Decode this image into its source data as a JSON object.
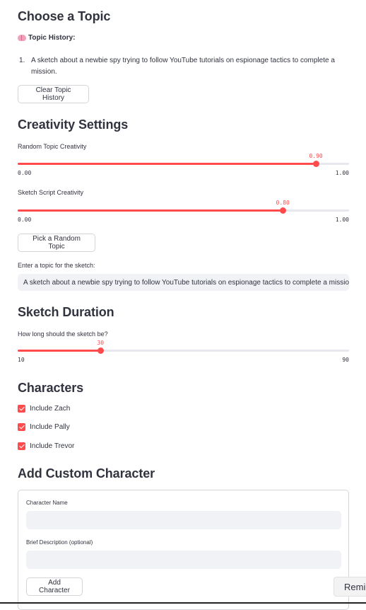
{
  "topic_section": {
    "heading": "Choose a Topic",
    "history_icon": "brain-icon",
    "history_label": "Topic History:",
    "history_items": [
      {
        "number": "1.",
        "text": "A sketch about a newbie spy trying to follow YouTube tutorials on espionage tactics to complete a mission."
      }
    ],
    "clear_button": "Clear Topic History"
  },
  "creativity_section": {
    "heading": "Creativity Settings",
    "random_topic": {
      "label": "Random Topic Creativity",
      "value": 0.9,
      "value_text": "0.90",
      "min": 0,
      "max": 1,
      "min_text": "0.00",
      "max_text": "1.00"
    },
    "sketch_script": {
      "label": "Sketch Script Creativity",
      "value": 0.8,
      "value_text": "0.80",
      "min": 0,
      "max": 1,
      "min_text": "0.00",
      "max_text": "1.00"
    },
    "random_button": "Pick a Random Topic",
    "topic_input_label": "Enter a topic for the sketch:",
    "topic_input_value": "A sketch about a newbie spy trying to follow YouTube tutorials on espionage tactics to complete a mission."
  },
  "duration_section": {
    "heading": "Sketch Duration",
    "slider": {
      "label": "How long should the sketch be?",
      "value": 30,
      "value_text": "30",
      "min": 10,
      "max": 90,
      "min_text": "10",
      "max_text": "90"
    }
  },
  "characters_section": {
    "heading": "Characters",
    "checkboxes": [
      {
        "label": "Include Zach",
        "checked": true
      },
      {
        "label": "Include Pally",
        "checked": true
      },
      {
        "label": "Include Trevor",
        "checked": true
      }
    ]
  },
  "custom_character_section": {
    "heading": "Add Custom Character",
    "name_label": "Character Name",
    "name_value": "",
    "description_label": "Brief Description (optional)",
    "description_value": "",
    "add_button": "Add Character"
  },
  "toast": {
    "text": "Remi"
  },
  "colors": {
    "accent": "#ff4b4b",
    "text": "#31333f",
    "input_bg": "#f0f2f6",
    "track": "#e6e8ee"
  }
}
